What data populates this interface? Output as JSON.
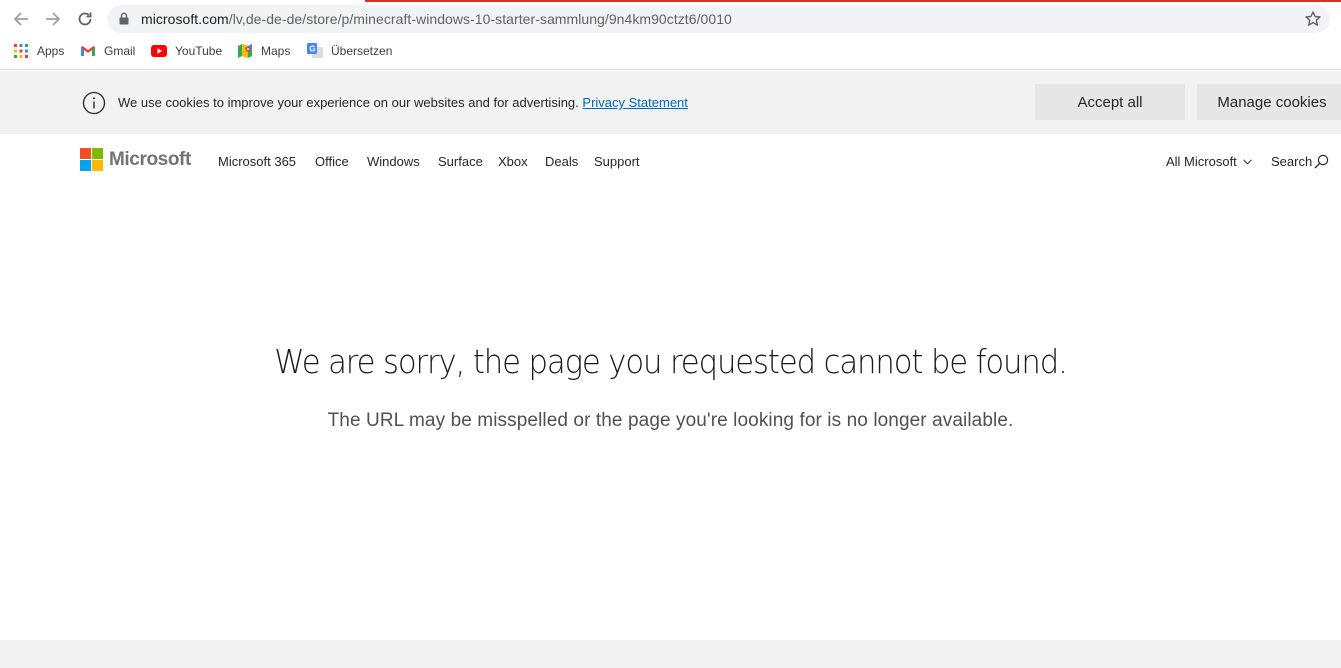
{
  "browser": {
    "url_domain": "microsoft.com",
    "url_path": "/lv,de-de-de/store/p/minecraft-windows-10-starter-sammlung/9n4km90ctzt6/0010",
    "bookmarks": [
      {
        "label": "Apps",
        "icon": "apps-grid-icon"
      },
      {
        "label": "Gmail",
        "icon": "gmail-icon"
      },
      {
        "label": "YouTube",
        "icon": "youtube-icon"
      },
      {
        "label": "Maps",
        "icon": "maps-icon"
      },
      {
        "label": "Übersetzen",
        "icon": "translate-icon"
      }
    ]
  },
  "cookie_banner": {
    "message": "We use cookies to improve your experience on our websites and for advertising.",
    "link": "Privacy Statement",
    "accept_label": "Accept all",
    "manage_label": "Manage cookies"
  },
  "header": {
    "brand": "Microsoft",
    "nav": [
      "Microsoft 365",
      "Office",
      "Windows",
      "Surface",
      "Xbox",
      "Deals",
      "Support"
    ],
    "all_microsoft": "All Microsoft",
    "search": "Search"
  },
  "error": {
    "title": "We are sorry, the page you requested cannot be found.",
    "subtitle": "The URL may be misspelled or the page you're looking for is no longer available."
  },
  "colors": {
    "ms_red": "#f25022",
    "ms_green": "#7fba00",
    "ms_blue": "#00a4ef",
    "ms_yellow": "#ffb900",
    "link": "#0067b8",
    "banner_bg": "#f2f2f2"
  }
}
